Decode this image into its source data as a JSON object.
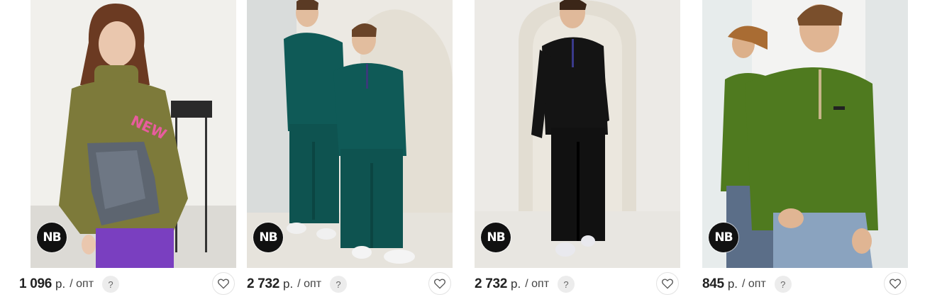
{
  "products": [
    {
      "brand_badge": "NB",
      "price": "1 096",
      "currency": "р.",
      "price_suffix": "/ опт",
      "help": "?",
      "garment_color": "#7d7a3a"
    },
    {
      "brand_badge": "NB",
      "price": "2 732",
      "currency": "р.",
      "price_suffix": "/ опт",
      "help": "?",
      "garment_color": "#0f5a57"
    },
    {
      "brand_badge": "NB",
      "price": "2 732",
      "currency": "р.",
      "price_suffix": "/ опт",
      "help": "?",
      "garment_color": "#141414"
    },
    {
      "brand_badge": "NB",
      "price": "845",
      "currency": "р.",
      "price_suffix": "/ опт",
      "help": "?",
      "garment_color": "#4f7a1f"
    }
  ],
  "icons": {
    "favorite": "heart-icon",
    "help": "question-icon"
  }
}
